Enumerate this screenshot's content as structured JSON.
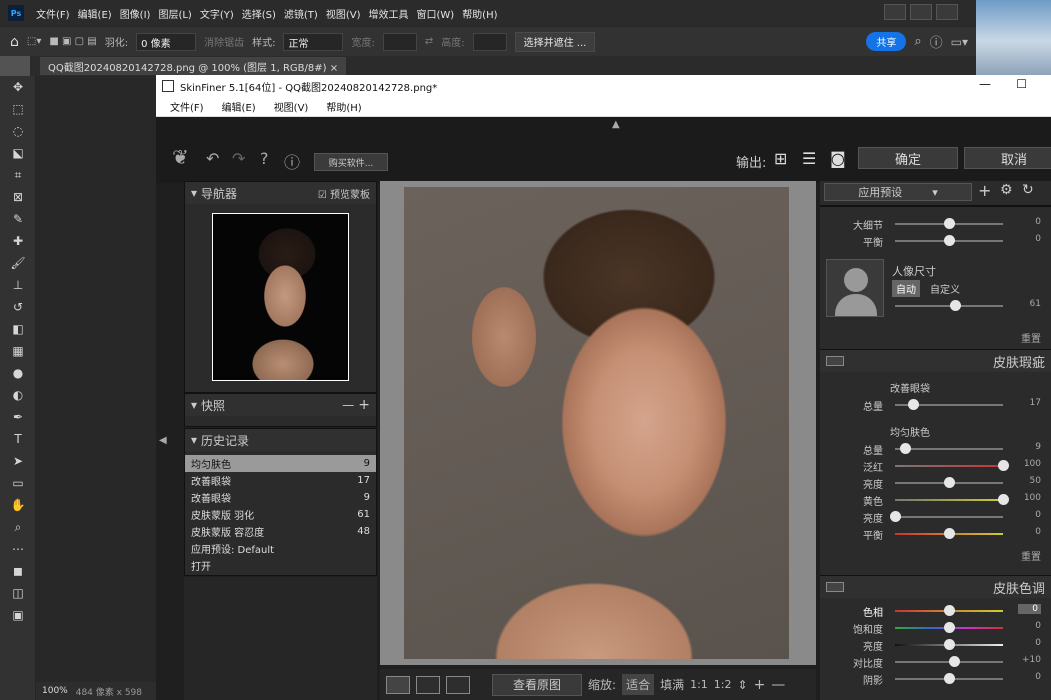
{
  "ps": {
    "logo": "Ps",
    "menu": [
      "文件(F)",
      "编辑(E)",
      "图像(I)",
      "图层(L)",
      "文字(Y)",
      "选择(S)",
      "滤镜(T)",
      "视图(V)",
      "增效工具",
      "窗口(W)",
      "帮助(H)"
    ],
    "options": {
      "feather_label": "羽化:",
      "feather_value": "0 像素",
      "antialias": "消除锯齿",
      "style_label": "样式:",
      "style_value": "正常",
      "width_label": "宽度:",
      "height_label": "高度:",
      "select_mask": "选择并遮住 ...",
      "share": "共享"
    },
    "doc_tab": "QQ截图20240820142728.png @ 100% (图层 1, RGB/8#)",
    "status": {
      "zoom": "100%",
      "size": "484 像素 x 598"
    }
  },
  "sf": {
    "title": "SkinFiner 5.1[64位] - QQ截图20240820142728.png*",
    "menu": [
      "文件(F)",
      "编辑(E)",
      "视图(V)",
      "帮助(H)"
    ],
    "toolbar": {
      "buy": "购买软件...",
      "output_label": "输出:",
      "ok": "确定",
      "cancel": "取消"
    },
    "navigator": {
      "title": "导航器",
      "preview_mask": "预览蒙板"
    },
    "snapshot": {
      "title": "快照"
    },
    "history": {
      "title": "历史记录",
      "items": [
        {
          "name": "均匀肤色",
          "value": "9"
        },
        {
          "name": "改善眼袋",
          "value": "17"
        },
        {
          "name": "改善眼袋",
          "value": "9"
        },
        {
          "name": "皮肤蒙版 羽化",
          "value": "61"
        },
        {
          "name": "皮肤蒙版 容忍度",
          "value": "48"
        },
        {
          "name": "应用预设: Default",
          "value": ""
        },
        {
          "name": "打开",
          "value": ""
        }
      ]
    },
    "bottom": {
      "view_original": "查看原图",
      "zoom_label": "缩放:",
      "fit": "适合",
      "fill": "填满",
      "r11": "1:1",
      "r12": "1:2"
    },
    "right": {
      "preset": "应用预设",
      "top_sliders": [
        {
          "label": "大细节",
          "value": "0",
          "pos": 0.5
        },
        {
          "label": "平衡",
          "value": "0",
          "pos": 0.5
        }
      ],
      "portrait": {
        "title": "人像尺寸",
        "auto": "自动",
        "custom": "自定义",
        "value": "61",
        "pos": 0.56
      },
      "reset": "重置",
      "blemish": {
        "title": "皮肤瑕疵",
        "sub1": "改善眼袋",
        "s1": [
          {
            "label": "总量",
            "value": "17",
            "pos": 0.17
          }
        ],
        "sub2": "均匀肤色",
        "s2": [
          {
            "label": "总量",
            "value": "9",
            "pos": 0.09
          },
          {
            "label": "泛红",
            "value": "100",
            "pos": 1.0
          },
          {
            "label": "亮度",
            "value": "50",
            "pos": 0.5
          },
          {
            "label": "黄色",
            "value": "100",
            "pos": 1.0
          },
          {
            "label": "亮度",
            "value": "0",
            "pos": 0.0
          },
          {
            "label": "平衡",
            "value": "0",
            "pos": 0.5
          }
        ]
      },
      "tone": {
        "title": "皮肤色调",
        "sliders": [
          {
            "label": "色相",
            "value": "0",
            "pos": 0.5
          },
          {
            "label": "饱和度",
            "value": "0",
            "pos": 0.5
          },
          {
            "label": "亮度",
            "value": "0",
            "pos": 0.5
          },
          {
            "label": "对比度",
            "value": "+10",
            "pos": 0.55
          },
          {
            "label": "阴影",
            "value": "0",
            "pos": 0.5
          }
        ]
      }
    }
  }
}
